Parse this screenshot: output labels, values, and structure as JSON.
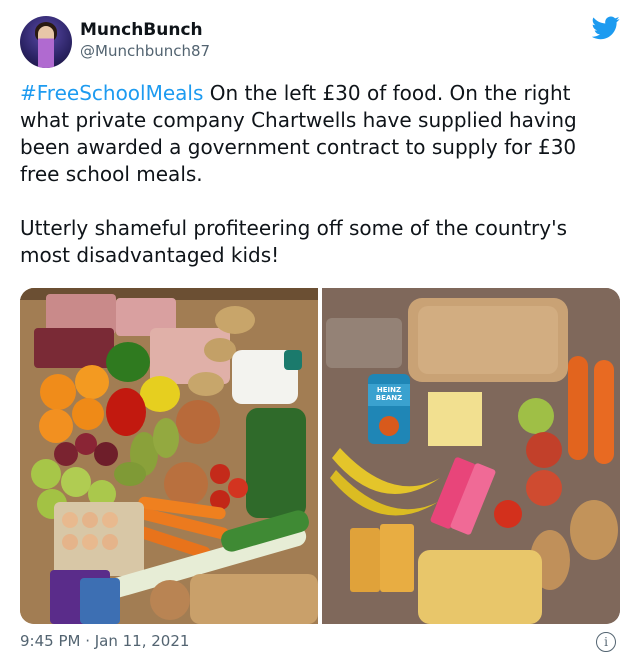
{
  "author": {
    "name": "MunchBunch",
    "handle": "@Munchbunch87",
    "avatar_icon": "profile-photo"
  },
  "brand_icon": "twitter-bird-icon",
  "brand_color": "#1d9bf0",
  "tweet": {
    "hashtag": "#FreeSchoolMeals",
    "paragraph1_rest": " On the left £30 of food. On the right what private company Chartwells have supplied having been awarded a government contract to supply for £30 free school meals.",
    "paragraph2": "Utterly shameful profiteering off some of the country's most disadvantaged kids!"
  },
  "photos": {
    "left": {
      "description_icon": "groceries-photo",
      "labels": {}
    },
    "right": {
      "description_icon": "food-parcel-photo",
      "tin_label": "HEINZ BEANZ"
    }
  },
  "footer": {
    "timestamp": "9:45 PM · Jan 11, 2021",
    "info_icon": "info-icon",
    "info_glyph": "i"
  }
}
